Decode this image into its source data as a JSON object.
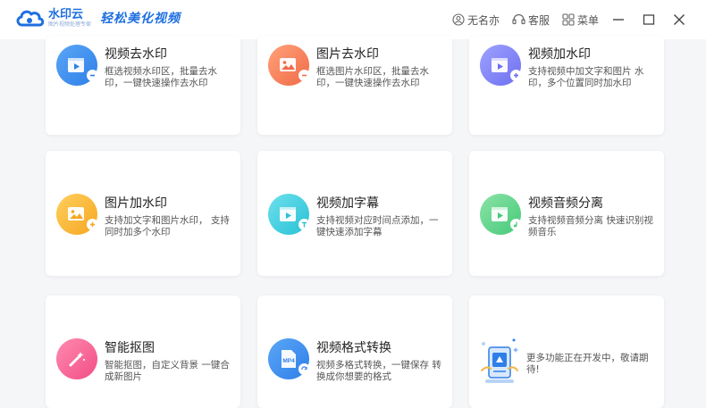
{
  "app": {
    "logo_name": "水印云",
    "logo_sub": "图片视频处理专家",
    "slogan": "轻松美化视频"
  },
  "header": {
    "user_label": "无名亦",
    "service_label": "客服",
    "menu_label": "菜单"
  },
  "cards": [
    {
      "title": "视频去水印",
      "desc": "框选视频水印区，批量去水印，一键快速操作去水印",
      "icon": "video-remove-watermark-icon",
      "color": "#2f7fe8"
    },
    {
      "title": "图片去水印",
      "desc": "框选图片水印区，批量去水印，一键快速操作去水印",
      "icon": "image-remove-watermark-icon",
      "color": "#f06a47"
    },
    {
      "title": "视频加水印",
      "desc": "支持视频中加文字和图片 水印，多个位置同时加水印",
      "icon": "video-add-watermark-icon",
      "color": "#6d6ff0"
    },
    {
      "title": "图片加水印",
      "desc": "支持加文字和图片水印， 支持同时加多个水印",
      "icon": "image-add-watermark-icon",
      "color": "#f6a623"
    },
    {
      "title": "视频加字幕",
      "desc": "支持视频对应时间点添加，一键快速添加字幕",
      "icon": "video-subtitle-icon",
      "color": "#27c1d6"
    },
    {
      "title": "视频音频分离",
      "desc": "支持视频音频分离 快速识别视频音乐",
      "icon": "audio-separate-icon",
      "color": "#46c97a"
    },
    {
      "title": "智能抠图",
      "desc": "智能抠图，自定义背景 一键合成新图片",
      "icon": "smart-cutout-icon",
      "color": "#f24d85"
    },
    {
      "title": "视频格式转换",
      "desc": "视频多格式转换，一键保存 转换成你想要的格式",
      "icon": "format-convert-icon",
      "color": "#2f7fe8",
      "icon_text": "MP4"
    }
  ],
  "more": {
    "text": "更多功能正在开发中，敬请期待!"
  }
}
